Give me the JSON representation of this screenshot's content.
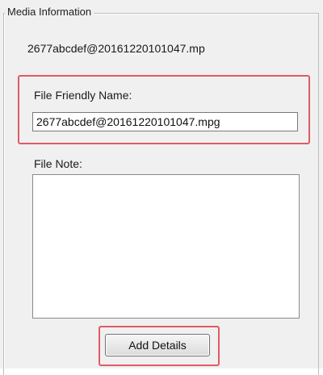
{
  "group": {
    "title": "Media Information"
  },
  "media": {
    "filename": "2677abcdef@20161220101047.mp"
  },
  "friendly_name": {
    "label": "File Friendly Name:",
    "value": "2677abcdef@20161220101047.mpg"
  },
  "file_note": {
    "label": "File Note:",
    "value": ""
  },
  "actions": {
    "add_details_label": "Add Details"
  },
  "colors": {
    "highlight": "#e05b63",
    "panel_background": "#f0f0f0"
  }
}
